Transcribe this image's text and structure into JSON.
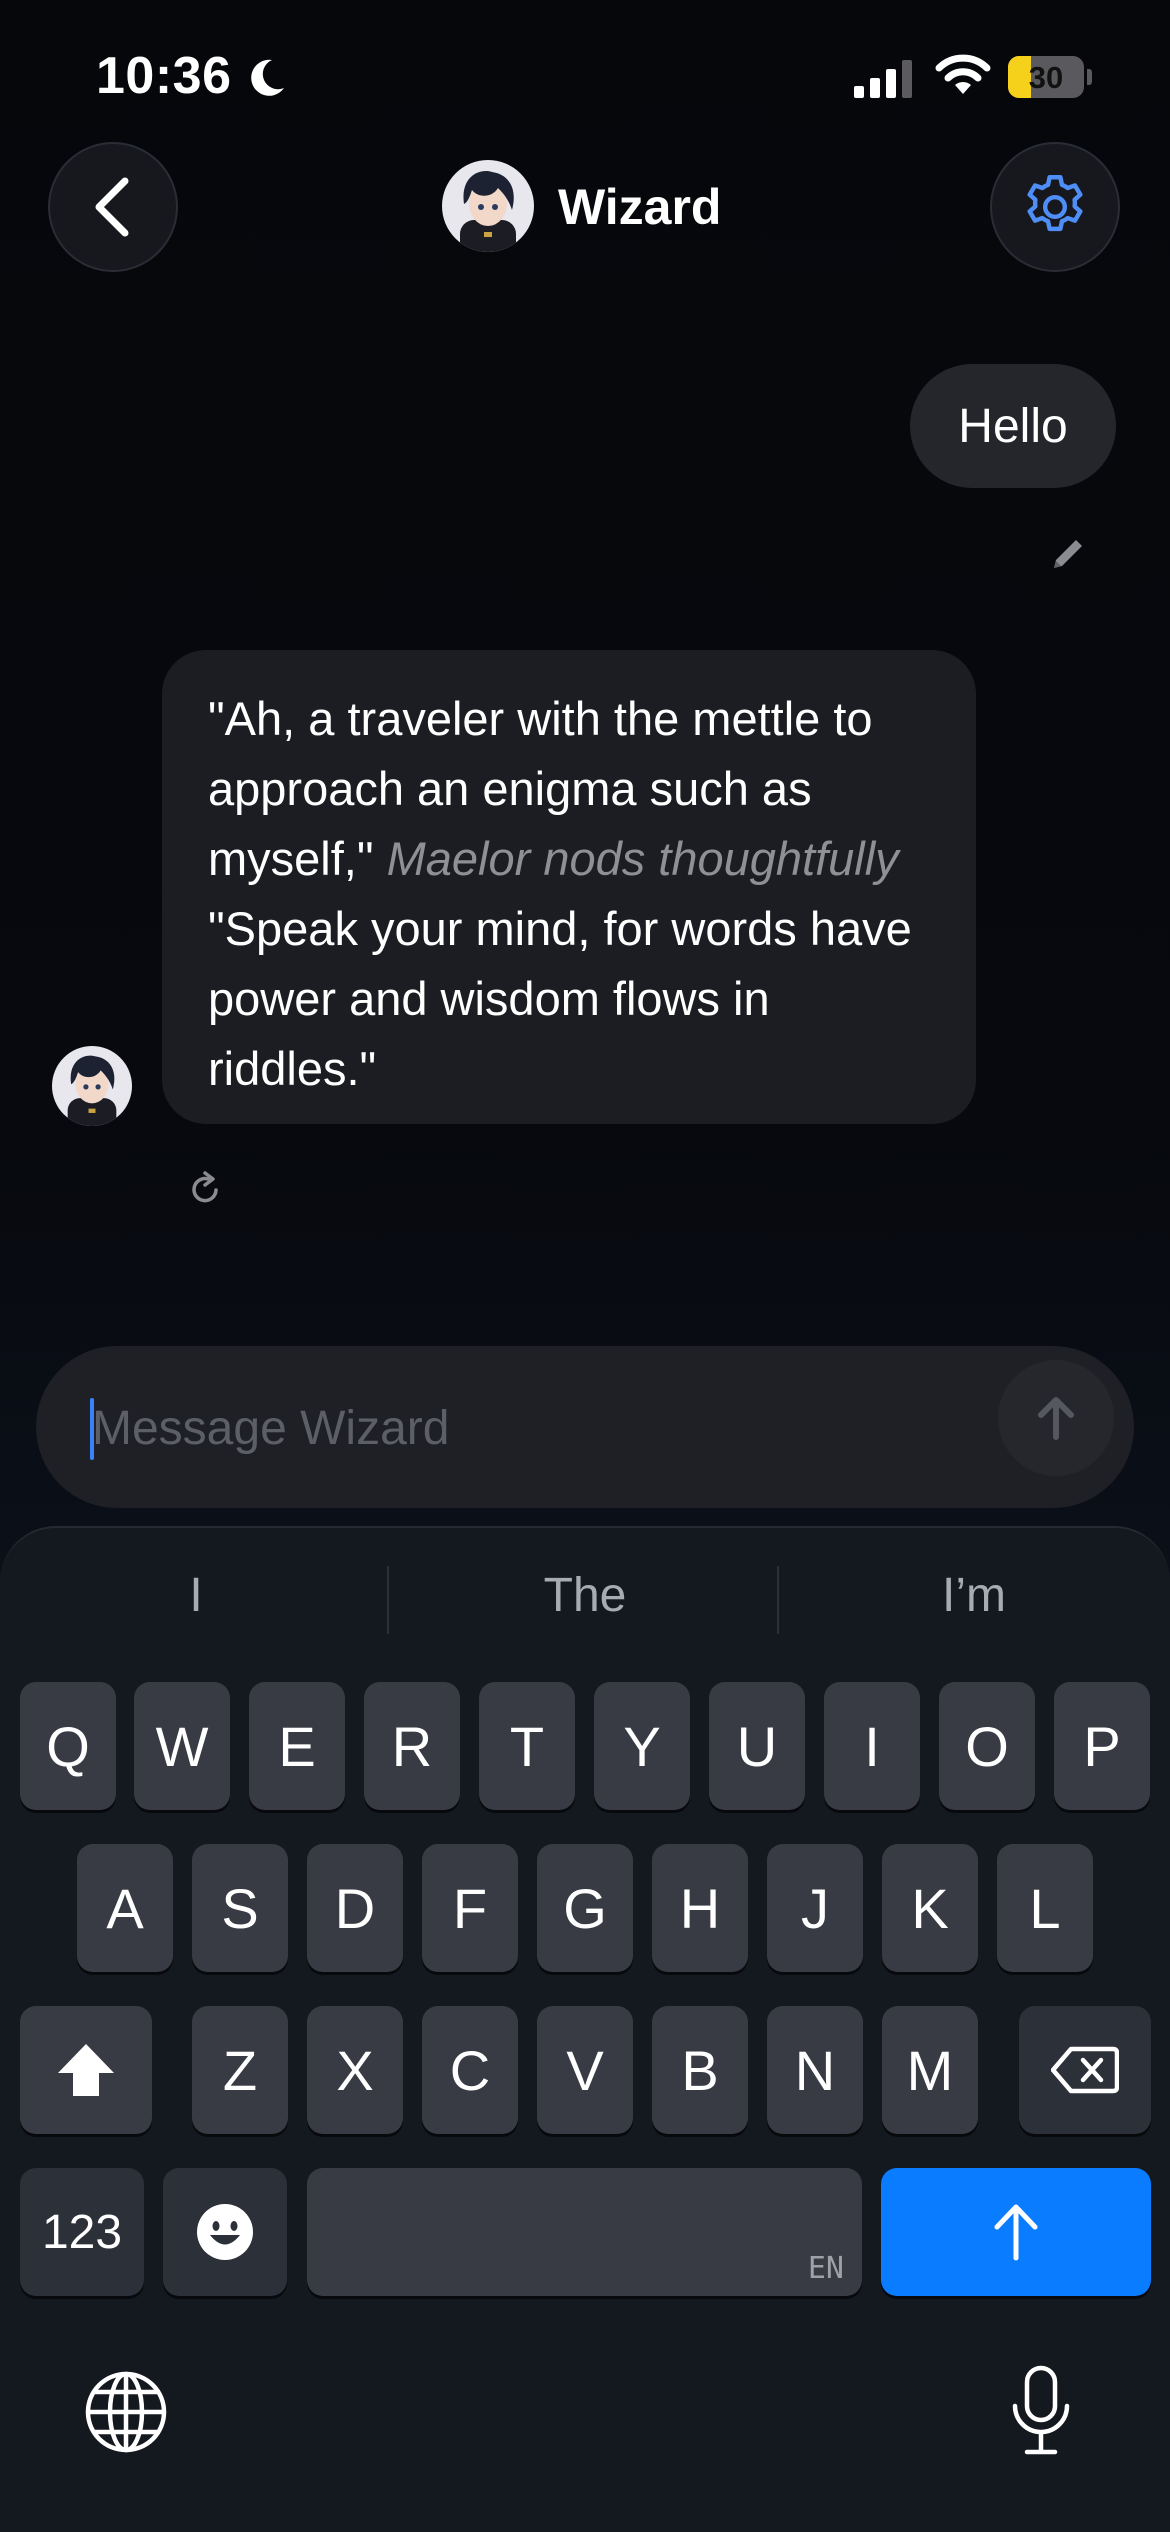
{
  "status_bar": {
    "time": "10:36",
    "battery_label": "30",
    "battery_level": 0.3,
    "icons": [
      "moon-icon",
      "signal-icon",
      "wifi-icon",
      "battery-icon"
    ]
  },
  "header": {
    "title": "Wizard",
    "back_icon": "chevron-left-icon",
    "settings_icon": "gear-icon",
    "accent_color": "#4f8ef7"
  },
  "messages": {
    "user_message": "Hello",
    "bot_message": {
      "part1": "\"Ah, a traveler with the mettle to approach an enigma such as myself,\" ",
      "action": "Maelor nods thoughtfully",
      "part2": " \"Speak your mind, for words have power and wisdom flows in riddles.\""
    }
  },
  "composer": {
    "placeholder": "Message Wizard",
    "send_icon": "arrow-up-icon"
  },
  "keyboard": {
    "suggestions": [
      "I",
      "The",
      "I’m"
    ],
    "row1": [
      "Q",
      "W",
      "E",
      "R",
      "T",
      "Y",
      "U",
      "I",
      "O",
      "P"
    ],
    "row2": [
      "A",
      "S",
      "D",
      "F",
      "G",
      "H",
      "J",
      "K",
      "L"
    ],
    "row3": [
      "Z",
      "X",
      "C",
      "V",
      "B",
      "N",
      "M"
    ],
    "numbers_key": "123",
    "space_language": "EN",
    "return_color": "#0a7cff"
  }
}
